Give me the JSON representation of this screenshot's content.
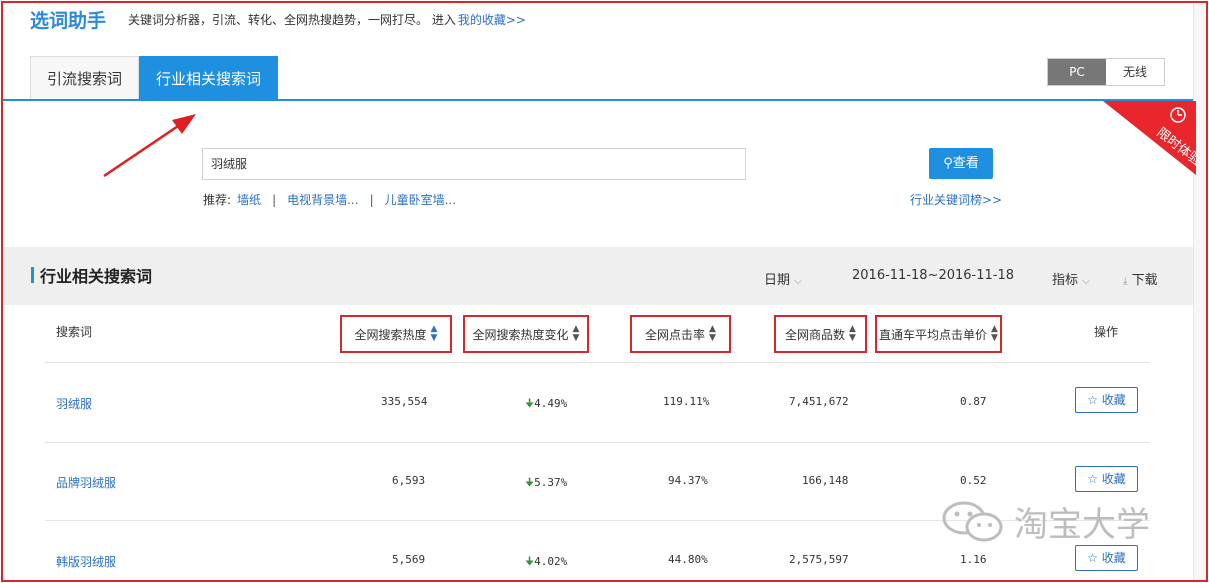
{
  "header": {
    "title": "选词助手",
    "description": "关键词分析器，引流、转化、全网热搜趋势，一网打尽。 进入",
    "favorites_link": "我的收藏>>"
  },
  "tabs": [
    {
      "label": "引流搜索词",
      "active": false
    },
    {
      "label": "行业相关搜索词",
      "active": true
    }
  ],
  "device_toggle": {
    "pc": "PC",
    "wireless": "无线",
    "selected": "PC"
  },
  "ribbon": {
    "text": "限时体验"
  },
  "search": {
    "value": "羽绒服",
    "button": "查看"
  },
  "recommend": {
    "label": "推荐:",
    "items": [
      "墙纸",
      "电视背景墙...",
      "儿童卧室墙..."
    ]
  },
  "rank_link": "行业关键词榜>>",
  "section": {
    "title": "行业相关搜索词",
    "date_label": "日期",
    "date_range": "2016-11-18~2016-11-18",
    "metric_label": "指标",
    "download_label": "下载"
  },
  "table": {
    "columns": [
      "搜索词",
      "全网搜索热度",
      "全网搜索热度变化",
      "全网点击率",
      "全网商品数",
      "直通车平均点击单价",
      "操作"
    ],
    "rows": [
      {
        "keyword": "羽绒服",
        "heat": "335,554",
        "heat_change": "4.49%",
        "ctr": "119.11%",
        "products": "7,451,672",
        "cpc": "0.87",
        "action": "收藏"
      },
      {
        "keyword": "品牌羽绒服",
        "heat": "6,593",
        "heat_change": "5.37%",
        "ctr": "94.37%",
        "products": "166,148",
        "cpc": "0.52",
        "action": "收藏"
      },
      {
        "keyword": "韩版羽绒服",
        "heat": "5,569",
        "heat_change": "4.02%",
        "ctr": "44.80%",
        "products": "2,575,597",
        "cpc": "1.16",
        "action": "收藏"
      }
    ]
  },
  "watermark": "淘宝大学",
  "colors": {
    "accent": "#1f8fe0",
    "highlight": "#d9262c",
    "link": "#2d6fc4",
    "down": "#2b9a2b"
  }
}
